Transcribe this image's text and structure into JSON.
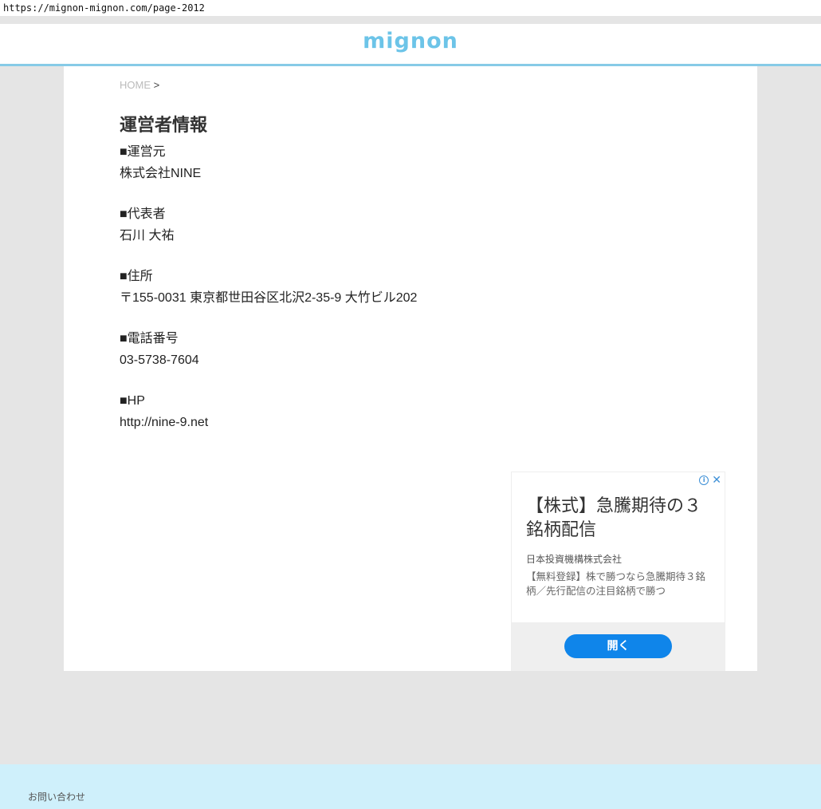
{
  "browser": {
    "url": "https://mignon-mignon.com/page-2012"
  },
  "header": {
    "logo": "mignon"
  },
  "breadcrumb": {
    "home": "HOME",
    "separator": ">"
  },
  "page": {
    "title": "運営者情報",
    "sections": [
      {
        "label": "■運営元",
        "value": "株式会社NINE"
      },
      {
        "label": "■代表者",
        "value": "石川 大祐"
      },
      {
        "label": "■住所",
        "value": "〒155-0031 東京都世田谷区北沢2-35-9 大竹ビル202"
      },
      {
        "label": "■電話番号",
        "value": "03-5738-7604"
      },
      {
        "label": "■HP",
        "value": "http://nine-9.net"
      }
    ]
  },
  "ad": {
    "info_icon": "info-icon",
    "close_icon": "close-icon",
    "close_glyph": "✕",
    "info_glyph": "i",
    "headline": "【株式】急騰期待の３銘柄配信",
    "advertiser": "日本投資機構株式会社",
    "body": "【無料登録】株で勝つなら急騰期待３銘柄／先行配信の注目銘柄で勝つ",
    "button": "開く",
    "accent_color": "#0f85ea"
  },
  "footer": {
    "contact": "お問い合わせ"
  },
  "colors": {
    "brand": "#6cc4e8",
    "header_border": "#87cbe7",
    "footer_bg": "#cff0fb"
  }
}
